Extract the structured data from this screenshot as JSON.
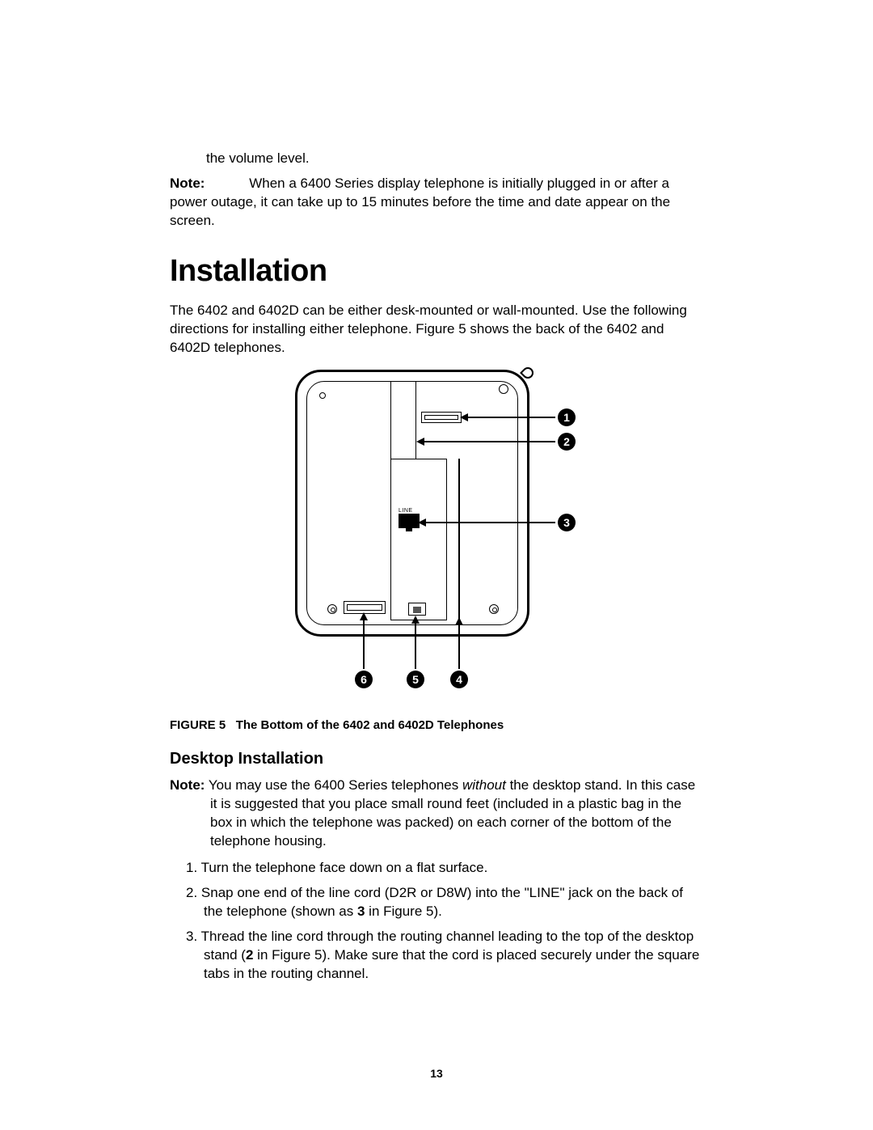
{
  "carry_over": "the volume level.",
  "note1": {
    "label": "Note:",
    "text": "When a 6400 Series display telephone is initially plugged in or after a power outage, it can take up to 15 minutes before the time and date appear on the screen."
  },
  "heading": "Installation",
  "intro": "The 6402 and 6402D can be either desk-mounted or wall-mounted. Use the following directions for installing either telephone. Figure 5 shows the back of the 6402 and 6402D telephones.",
  "figure": {
    "callouts": {
      "c1": "1",
      "c2": "2",
      "c3": "3",
      "c4": "4",
      "c5": "5",
      "c6": "6"
    },
    "line_label": "LINE",
    "caption_prefix": "FIGURE 5",
    "caption_text": "The Bottom of the 6402 and 6402D Telephones"
  },
  "subheading": "Desktop Installation",
  "note2": {
    "label": "Note:",
    "pre": "You may use the 6400 Series telephones ",
    "italic": "without",
    "post": " the desktop stand. In this case it is suggested that you place small round feet (included in a plastic bag in the box in which the telephone was packed) on each corner of the bottom of the telephone housing."
  },
  "steps": {
    "s1": {
      "num": "1.",
      "text": "Turn the telephone face down on a flat surface."
    },
    "s2": {
      "num": "2.",
      "pre": "Snap one end of the line cord (D2R or D8W) into the \"LINE\" jack on the back of the telephone (shown as ",
      "bold": "3",
      "post": " in Figure 5)."
    },
    "s3": {
      "num": "3.",
      "pre": "Thread the line cord through the routing channel leading to the top of the desktop stand (",
      "bold": "2",
      "post": " in Figure 5). Make sure that the cord is placed securely under the square tabs in the routing channel."
    }
  },
  "page_number": "13"
}
